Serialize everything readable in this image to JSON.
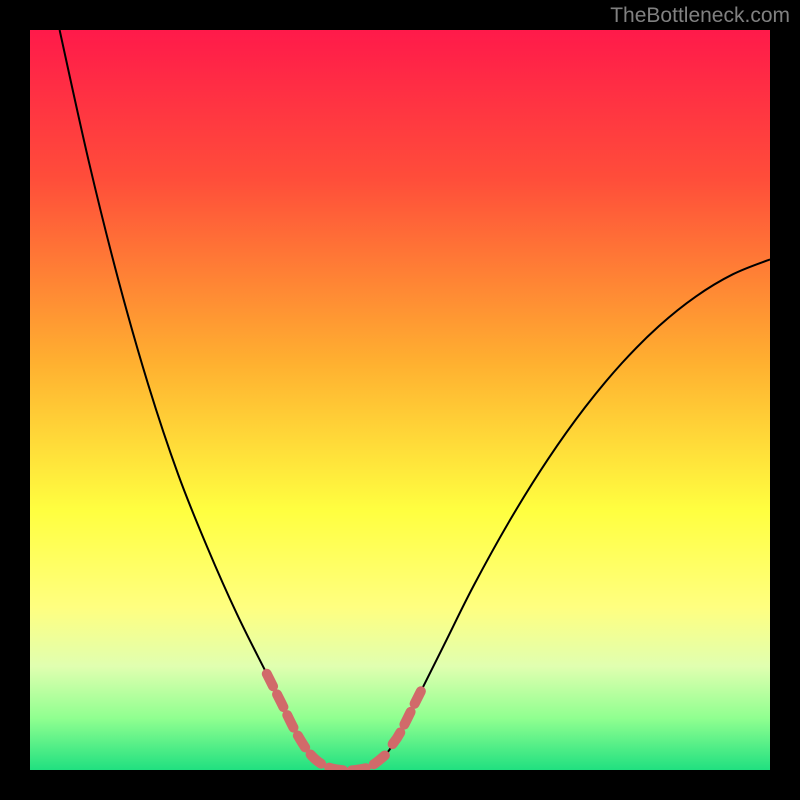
{
  "watermark": "TheBottleneck.com",
  "chart_data": {
    "type": "line",
    "title": "",
    "xlabel": "",
    "ylabel": "",
    "xlim": [
      0,
      100
    ],
    "ylim": [
      0,
      100
    ],
    "gradient_stops": [
      {
        "offset": 0,
        "color": "#ff1a4a"
      },
      {
        "offset": 20,
        "color": "#ff4d3a"
      },
      {
        "offset": 45,
        "color": "#ffb030"
      },
      {
        "offset": 65,
        "color": "#ffff40"
      },
      {
        "offset": 78,
        "color": "#ffff80"
      },
      {
        "offset": 86,
        "color": "#e0ffb0"
      },
      {
        "offset": 93,
        "color": "#90ff90"
      },
      {
        "offset": 100,
        "color": "#20e080"
      }
    ],
    "series": [
      {
        "name": "curve",
        "color": "#000000",
        "stroke_width": 2,
        "points": [
          {
            "x": 4,
            "y": 100
          },
          {
            "x": 8,
            "y": 82
          },
          {
            "x": 12,
            "y": 66
          },
          {
            "x": 16,
            "y": 52
          },
          {
            "x": 20,
            "y": 40
          },
          {
            "x": 24,
            "y": 30
          },
          {
            "x": 28,
            "y": 21
          },
          {
            "x": 32,
            "y": 13
          },
          {
            "x": 34,
            "y": 9
          },
          {
            "x": 36,
            "y": 5
          },
          {
            "x": 38,
            "y": 2
          },
          {
            "x": 40,
            "y": 0.5
          },
          {
            "x": 42,
            "y": 0
          },
          {
            "x": 44,
            "y": 0
          },
          {
            "x": 46,
            "y": 0.5
          },
          {
            "x": 48,
            "y": 2
          },
          {
            "x": 50,
            "y": 5
          },
          {
            "x": 52,
            "y": 9
          },
          {
            "x": 56,
            "y": 17
          },
          {
            "x": 60,
            "y": 25
          },
          {
            "x": 65,
            "y": 34
          },
          {
            "x": 70,
            "y": 42
          },
          {
            "x": 75,
            "y": 49
          },
          {
            "x": 80,
            "y": 55
          },
          {
            "x": 85,
            "y": 60
          },
          {
            "x": 90,
            "y": 64
          },
          {
            "x": 95,
            "y": 67
          },
          {
            "x": 100,
            "y": 69
          }
        ]
      },
      {
        "name": "highlight-segments",
        "color": "#d16a6a",
        "stroke_width": 10,
        "segments": [
          [
            {
              "x": 32,
              "y": 13
            },
            {
              "x": 34,
              "y": 9
            },
            {
              "x": 36,
              "y": 5
            },
            {
              "x": 38,
              "y": 2
            },
            {
              "x": 40,
              "y": 0.5
            },
            {
              "x": 42,
              "y": 0
            },
            {
              "x": 44,
              "y": 0
            },
            {
              "x": 46,
              "y": 0.5
            },
            {
              "x": 48,
              "y": 2
            }
          ],
          [
            {
              "x": 49,
              "y": 3.5
            },
            {
              "x": 50,
              "y": 5
            },
            {
              "x": 52,
              "y": 9
            },
            {
              "x": 53,
              "y": 11
            }
          ]
        ]
      }
    ]
  }
}
